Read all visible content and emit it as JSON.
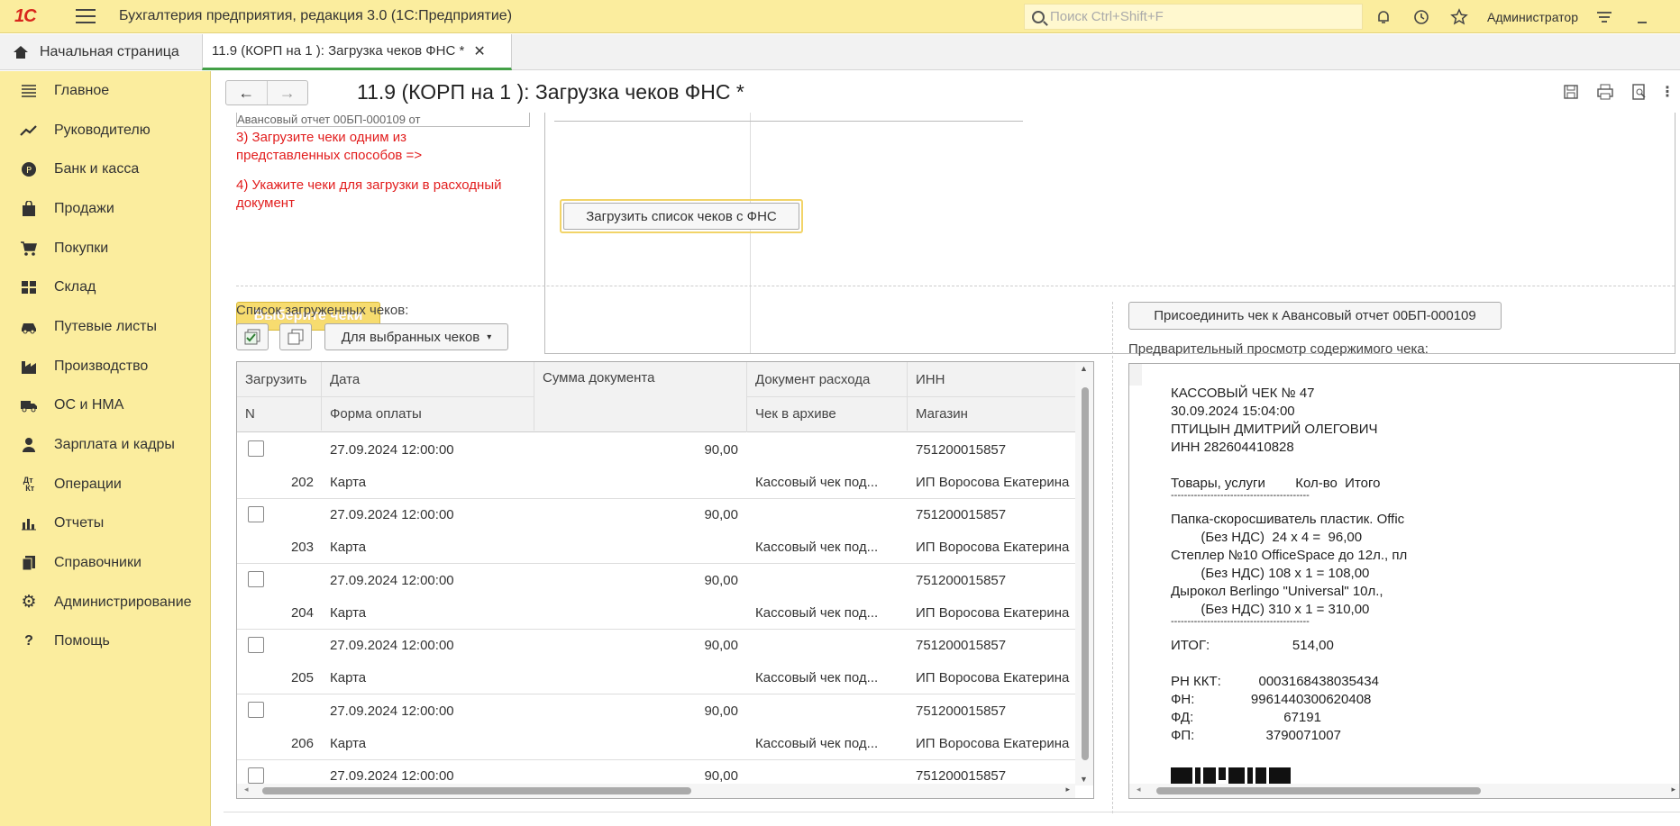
{
  "app": {
    "logo": "1С",
    "title": "Бухгалтерия предприятия, редакция 3.0  (1С:Предприятие)",
    "search_placeholder": "Поиск Ctrl+Shift+F",
    "user": "Администратор"
  },
  "tabs": {
    "home": "Начальная страница",
    "active": "11.9 (КОРП на 1 ): Загрузка чеков ФНС *"
  },
  "sidebar": {
    "items": [
      {
        "label": "Главное",
        "icon": "menu-lines-icon"
      },
      {
        "label": "Руководителю",
        "icon": "trend-icon"
      },
      {
        "label": "Банк и касса",
        "icon": "coin-icon"
      },
      {
        "label": "Продажи",
        "icon": "bag-icon"
      },
      {
        "label": "Покупки",
        "icon": "cart-icon"
      },
      {
        "label": "Склад",
        "icon": "grid-icon"
      },
      {
        "label": "Путевые листы",
        "icon": "car-icon"
      },
      {
        "label": "Производство",
        "icon": "factory-icon"
      },
      {
        "label": "ОС и НМА",
        "icon": "truck-icon"
      },
      {
        "label": "Зарплата и кадры",
        "icon": "person-icon"
      },
      {
        "label": "Операции",
        "icon": "dt-kt-icon"
      },
      {
        "label": "Отчеты",
        "icon": "bar-chart-icon"
      },
      {
        "label": "Справочники",
        "icon": "books-icon"
      },
      {
        "label": "Администрирование",
        "icon": "gear-icon"
      },
      {
        "label": "Помощь",
        "icon": "question-icon"
      }
    ]
  },
  "form": {
    "title": "11.9 (КОРП на 1 ): Загрузка чеков ФНС *",
    "combo_partial": "Авансовый отчет 00БП-000109 от",
    "step3": "3) Загрузите чеки одним из представленных способов =>",
    "step4": "4) Укажите чеки для загрузки в расходный документ",
    "select_checks_button": "Выберите чеки",
    "load_fns_button": "Загрузить список чеков с ФНС",
    "list_label": "Список загруженных чеков:",
    "for_selected_button": "Для выбранных чеков",
    "attach_button": "Присоединить чек к Авансовый отчет 00БП-000109",
    "preview_label": "Предварительный просмотр содержимого чека:"
  },
  "table": {
    "headers_row1": [
      "Загрузить",
      "Дата",
      "Сумма документа",
      "Документ расхода",
      "ИНН"
    ],
    "headers_row2": [
      "N",
      "Форма оплаты",
      "",
      "Чек в архиве",
      "Магазин"
    ],
    "rows": [
      {
        "n": "202",
        "date": "27.09.2024 12:00:00",
        "sum": "90,00",
        "inn": "751200015857",
        "pay": "Карта",
        "archive": "Кассовый чек под...",
        "shop": "ИП Воросова Екатерина"
      },
      {
        "n": "203",
        "date": "27.09.2024 12:00:00",
        "sum": "90,00",
        "inn": "751200015857",
        "pay": "Карта",
        "archive": "Кассовый чек под...",
        "shop": "ИП Воросова Екатерина"
      },
      {
        "n": "204",
        "date": "27.09.2024 12:00:00",
        "sum": "90,00",
        "inn": "751200015857",
        "pay": "Карта",
        "archive": "Кассовый чек под...",
        "shop": "ИП Воросова Екатерина"
      },
      {
        "n": "205",
        "date": "27.09.2024 12:00:00",
        "sum": "90,00",
        "inn": "751200015857",
        "pay": "Карта",
        "archive": "Кассовый чек под...",
        "shop": "ИП Воросова Екатерина"
      },
      {
        "n": "206",
        "date": "27.09.2024 12:00:00",
        "sum": "90,00",
        "inn": "751200015857",
        "pay": "Карта",
        "archive": "Кассовый чек под...",
        "shop": "ИП Воросова Екатерина"
      },
      {
        "n": "",
        "date": "27.09.2024 12:00:00",
        "sum": "90,00",
        "inn": "751200015857",
        "pay": "",
        "archive": "",
        "shop": ""
      }
    ]
  },
  "receipt": {
    "lines": [
      "КАССОВЫЙ ЧЕК № 47",
      "30.09.2024 15:04:00",
      "ПТИЦЫН ДМИТРИЙ ОЛЕГОВИЧ",
      "ИНН 282604410828",
      "",
      "Товары, услуги        Кол-во  Итого",
      "------------------------------------------",
      "Папка-скоросшиватель пластик. Offic",
      "        (Без НДС)  24 x 4 =  96,00",
      "Степлер №10 OfficeSpace до 12л., пл",
      "        (Без НДС) 108 x 1 = 108,00",
      "Дырокол Berlingo \"Universal\" 10л.,",
      "        (Без НДС) 310 x 1 = 310,00",
      "------------------------------------------",
      "ИТОГ:                      514,00",
      "",
      "РН ККТ:          0003168438035434",
      "ФН:               9961440300620408",
      "ФД:                        67191",
      "ФП:                   3790071007"
    ]
  }
}
